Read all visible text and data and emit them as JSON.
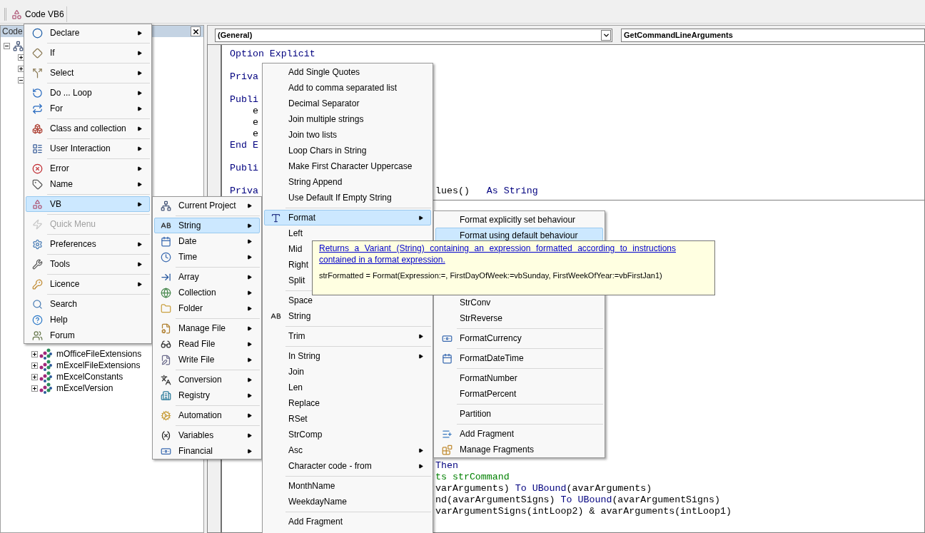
{
  "toolbar": {
    "button": "Code VB6"
  },
  "explorer": {
    "title": "Code",
    "tree": {
      "expanded": true,
      "children": [
        {
          "expanded": false
        },
        {
          "expanded": false
        },
        {
          "expanded": true,
          "children": [
            {
              "label": "mOfficeFileExtensions",
              "expanded": false
            },
            {
              "label": "mExcelFileExtensions",
              "expanded": false
            },
            {
              "label": "mExcelConstants",
              "expanded": false
            },
            {
              "label": "mExcelVersion",
              "expanded": false
            }
          ]
        }
      ]
    }
  },
  "editor": {
    "object_combo": "(General)",
    "procedure_combo": "GetCommandLineArguments",
    "top_pane": [
      [
        {
          "left": [
            {
              "text": "Option Explicit",
              "kind": "keyword"
            }
          ]
        }
      ],
      [
        {
          "left": [
            {
              "text": "Priva",
              "kind": "keyword"
            }
          ]
        }
      ],
      [
        {
          "left": [
            {
              "text": "Publi",
              "kind": "keyword"
            }
          ]
        },
        {
          "left": [
            {
              "text": "    e",
              "kind": "plain"
            }
          ]
        },
        {
          "left": [
            {
              "text": "    e",
              "kind": "plain"
            }
          ]
        },
        {
          "left": [
            {
              "text": "    e",
              "kind": "plain"
            }
          ]
        },
        {
          "left": [
            {
              "text": "End E",
              "kind": "keyword"
            }
          ]
        }
      ],
      [
        {
          "left": [
            {
              "text": "Publi",
              "kind": "keyword"
            }
          ]
        }
      ],
      [
        {
          "left": [
            {
              "text": "Priva",
              "kind": "keyword"
            }
          ],
          "right": [
            {
              "text": "lues()   ",
              "kind": "plain"
            },
            {
              "text": "As String",
              "kind": "keyword"
            }
          ]
        }
      ]
    ],
    "bottom_pane": [
      {
        "right": [
          {
            "text": "Then",
            "kind": "keyword"
          }
        ]
      },
      {
        "right": [
          {
            "text": "ts strCommand",
            "kind": "comment"
          }
        ]
      },
      {
        "right": [
          {
            "text": "varArguments) ",
            "kind": "plain"
          },
          {
            "text": "To UBound",
            "kind": "keyword"
          },
          {
            "text": "(avarArguments)",
            "kind": "plain"
          }
        ]
      },
      {
        "right": [
          {
            "text": "nd(avarArgumentSigns) ",
            "kind": "plain"
          },
          {
            "text": "To UBound",
            "kind": "keyword"
          },
          {
            "text": "(avarArgumentSigns)",
            "kind": "plain"
          }
        ]
      },
      {
        "right": [
          {
            "text": "varArgumentSigns(intLoop2) & avarArguments(intLoop1)",
            "kind": "plain"
          }
        ]
      }
    ]
  },
  "main_menu": {
    "groups": [
      [
        {
          "label": "Declare",
          "submenu": true,
          "selected": false,
          "disabled": false
        }
      ],
      [
        {
          "label": "If",
          "submenu": true,
          "selected": false,
          "disabled": false
        }
      ],
      [
        {
          "label": "Select",
          "submenu": true,
          "selected": false,
          "disabled": false
        }
      ],
      [
        {
          "label": "Do ... Loop",
          "submenu": true,
          "selected": false,
          "disabled": false
        },
        {
          "label": "For",
          "submenu": true,
          "selected": false,
          "disabled": false
        }
      ],
      [
        {
          "label": "Class and collection",
          "submenu": true,
          "selected": false,
          "disabled": false
        }
      ],
      [
        {
          "label": "User Interaction",
          "submenu": true,
          "selected": false,
          "disabled": false
        }
      ],
      [
        {
          "label": "Error",
          "submenu": true,
          "selected": false,
          "disabled": false
        },
        {
          "label": "Name",
          "submenu": true,
          "selected": false,
          "disabled": false
        }
      ],
      [
        {
          "label": "VB",
          "submenu": true,
          "selected": true,
          "disabled": false
        }
      ],
      [
        {
          "label": "Quick Menu",
          "submenu": false,
          "selected": false,
          "disabled": true
        }
      ],
      [
        {
          "label": "Preferences",
          "submenu": true,
          "selected": false,
          "disabled": false
        }
      ],
      [
        {
          "label": "Tools",
          "submenu": true,
          "selected": false,
          "disabled": false
        }
      ],
      [
        {
          "label": "Licence",
          "submenu": true,
          "selected": false,
          "disabled": false
        }
      ],
      [
        {
          "label": "Search",
          "submenu": false,
          "selected": false,
          "disabled": false
        },
        {
          "label": "Help",
          "submenu": false,
          "selected": false,
          "disabled": false
        },
        {
          "label": "Forum",
          "submenu": false,
          "selected": false,
          "disabled": false
        }
      ]
    ]
  },
  "vb_menu": {
    "groups": [
      [
        {
          "label": "Current Project",
          "submenu": true,
          "selected": false
        }
      ],
      [
        {
          "label": "String",
          "submenu": true,
          "selected": true
        },
        {
          "label": "Date",
          "submenu": true,
          "selected": false
        },
        {
          "label": "Time",
          "submenu": true,
          "selected": false
        }
      ],
      [
        {
          "label": "Array",
          "submenu": true,
          "selected": false
        },
        {
          "label": "Collection",
          "submenu": true,
          "selected": false
        },
        {
          "label": "Folder",
          "submenu": true,
          "selected": false
        }
      ],
      [
        {
          "label": "Manage File",
          "submenu": true,
          "selected": false
        },
        {
          "label": "Read File",
          "submenu": true,
          "selected": false
        },
        {
          "label": "Write File",
          "submenu": true,
          "selected": false
        }
      ],
      [
        {
          "label": "Conversion",
          "submenu": true,
          "selected": false
        },
        {
          "label": "Registry",
          "submenu": true,
          "selected": false
        }
      ],
      [
        {
          "label": "Automation",
          "submenu": true,
          "selected": false
        }
      ],
      [
        {
          "label": "Variables",
          "submenu": true,
          "selected": false
        },
        {
          "label": "Financial",
          "submenu": true,
          "selected": false
        }
      ]
    ]
  },
  "string_menu": {
    "groups": [
      [
        {
          "label": "Add Single Quotes",
          "submenu": false,
          "selected": false
        },
        {
          "label": "Add to comma separated list",
          "submenu": false,
          "selected": false
        },
        {
          "label": "Decimal Separator",
          "submenu": false,
          "selected": false
        },
        {
          "label": "Join multiple strings",
          "submenu": false,
          "selected": false
        },
        {
          "label": "Join two lists",
          "submenu": false,
          "selected": false
        },
        {
          "label": "Loop Chars in String",
          "submenu": false,
          "selected": false
        },
        {
          "label": "Make First Character Uppercase",
          "submenu": false,
          "selected": false
        },
        {
          "label": "String Append",
          "submenu": false,
          "selected": false
        },
        {
          "label": "Use Default If Empty String",
          "submenu": false,
          "selected": false
        }
      ],
      [
        {
          "label": "Format",
          "submenu": true,
          "selected": true
        },
        {
          "label": "Left",
          "submenu": false,
          "selected": false
        },
        {
          "label": "Mid",
          "selected": false
        },
        {
          "label": "Right",
          "selected": false
        },
        {
          "label": "Split",
          "selected": false
        }
      ],
      [
        {
          "label": "Space",
          "submenu": false,
          "selected": false
        },
        {
          "label": "String",
          "submenu": false,
          "selected": false
        }
      ],
      [
        {
          "label": "Trim",
          "submenu": true,
          "selected": false
        }
      ],
      [
        {
          "label": "In String",
          "submenu": true,
          "selected": false
        },
        {
          "label": "Join",
          "submenu": false,
          "selected": false
        },
        {
          "label": "Len",
          "submenu": false,
          "selected": false
        },
        {
          "label": "Replace",
          "submenu": false,
          "selected": false
        },
        {
          "label": "RSet",
          "submenu": false,
          "selected": false
        },
        {
          "label": "StrComp",
          "submenu": false,
          "selected": false
        },
        {
          "label": "Asc",
          "submenu": true,
          "selected": false
        },
        {
          "label": "Character code - from",
          "submenu": true,
          "selected": false
        }
      ],
      [
        {
          "label": "MonthName",
          "submenu": false,
          "selected": false
        },
        {
          "label": "WeekdayName",
          "submenu": false,
          "selected": false
        }
      ],
      [
        {
          "label": "Add Fragment",
          "submenu": false,
          "selected": false
        }
      ]
    ]
  },
  "format_menu": {
    "groups": [
      [
        {
          "label": "Format explicitly set behaviour",
          "submenu": false,
          "selected": false
        },
        {
          "label": "Format using default behaviour",
          "submenu": false,
          "selected": true
        },
        {
          "label": "StrConv",
          "submenu": false,
          "selected": false
        },
        {
          "label": "StrReverse",
          "submenu": false,
          "selected": false
        }
      ],
      [
        {
          "label": "FormatCurrency",
          "submenu": false,
          "selected": false
        }
      ],
      [
        {
          "label": "FormatDateTime",
          "submenu": false,
          "selected": false
        }
      ],
      [
        {
          "label": "FormatNumber",
          "submenu": false,
          "selected": false
        },
        {
          "label": "FormatPercent",
          "submenu": false,
          "selected": false
        }
      ],
      [
        {
          "label": "Partition",
          "submenu": false,
          "selected": false
        }
      ],
      [
        {
          "label": "Add Fragment",
          "submenu": false,
          "selected": false
        },
        {
          "label": "Manage Fragments",
          "submenu": false,
          "selected": false
        }
      ]
    ]
  },
  "tooltip": {
    "link": "Returns a Variant (String) containing an expression formatted according to instructions contained in a format expression.",
    "syntax": "strFormatted = Format(Expression:=, FirstDayOfWeek:=vbSunday, FirstWeekOfYear:=vbFirstJan1)"
  }
}
